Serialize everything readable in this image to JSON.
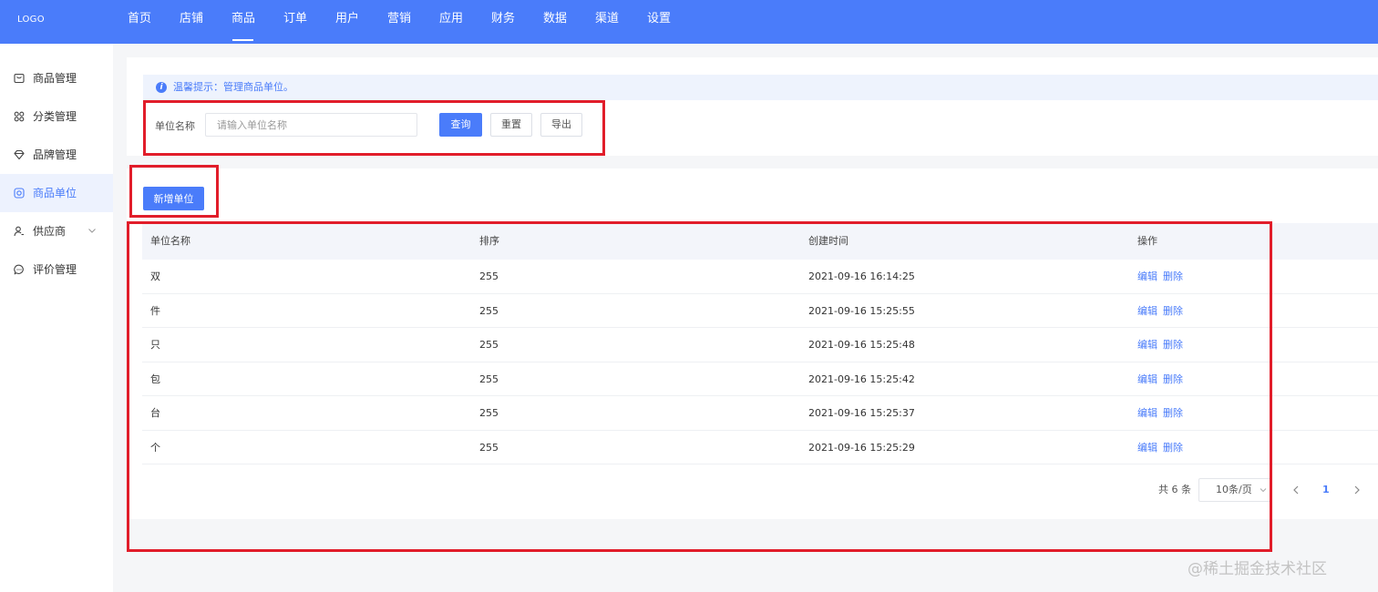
{
  "header": {
    "logo": "LOGO",
    "nav": [
      "首页",
      "店铺",
      "商品",
      "订单",
      "用户",
      "营销",
      "应用",
      "财务",
      "数据",
      "渠道",
      "设置"
    ],
    "active_nav": "商品"
  },
  "sidebar": {
    "items": [
      {
        "label": "商品管理",
        "icon": "box-icon"
      },
      {
        "label": "分类管理",
        "icon": "grid-icon"
      },
      {
        "label": "品牌管理",
        "icon": "diamond-icon"
      },
      {
        "label": "商品单位",
        "icon": "unit-icon"
      },
      {
        "label": "供应商",
        "icon": "user-icon"
      },
      {
        "label": "评价管理",
        "icon": "chat-icon"
      }
    ],
    "active": "商品单位"
  },
  "filter": {
    "tip": "温馨提示：管理商品单位。",
    "label": "单位名称",
    "placeholder": "请输入单位名称",
    "value": "",
    "query": "查询",
    "reset": "重置",
    "export": "导出"
  },
  "actions": {
    "add": "新增单位"
  },
  "table": {
    "columns": [
      "单位名称",
      "排序",
      "创建时间",
      "操作"
    ],
    "rows": [
      {
        "name": "双",
        "sort": "255",
        "created": "2021-09-16 16:14:25"
      },
      {
        "name": "件",
        "sort": "255",
        "created": "2021-09-16 15:25:55"
      },
      {
        "name": "只",
        "sort": "255",
        "created": "2021-09-16 15:25:48"
      },
      {
        "name": "包",
        "sort": "255",
        "created": "2021-09-16 15:25:42"
      },
      {
        "name": "台",
        "sort": "255",
        "created": "2021-09-16 15:25:37"
      },
      {
        "name": "个",
        "sort": "255",
        "created": "2021-09-16 15:25:29"
      }
    ],
    "edit": "编辑",
    "delete": "删除"
  },
  "pagination": {
    "total": "共 6 条",
    "page_size": "10条/页",
    "current": "1"
  },
  "colors": {
    "primary": "#4a7cfa",
    "highlight": "#e11d2a"
  },
  "watermark": "@稀土掘金技术社区"
}
